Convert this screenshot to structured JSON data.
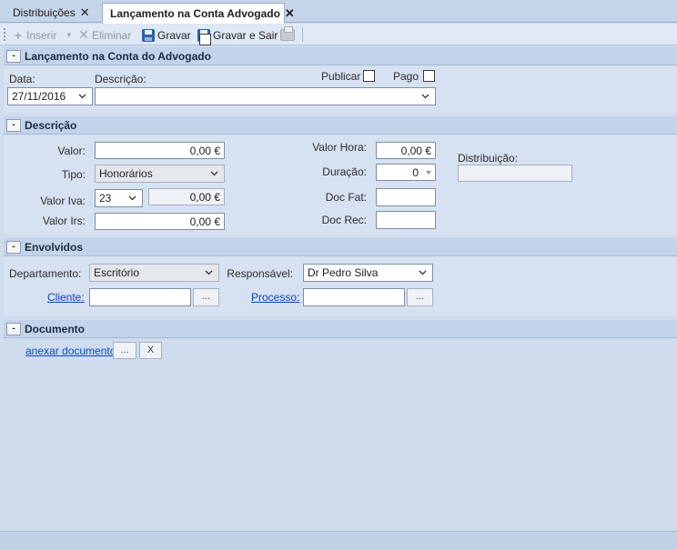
{
  "tabs": [
    {
      "label": "Distribuições",
      "active": false
    },
    {
      "label": "Lançamento na Conta Advogado",
      "active": true
    }
  ],
  "toolbar": {
    "insert_label": "Inserir",
    "delete_label": "Eliminar",
    "save_label": "Gravar",
    "save_exit_label": "Gravar e Sair"
  },
  "section_main": {
    "title": "Lançamento na Conta do Advogado",
    "date_label": "Data:",
    "date_value": "27/11/2016",
    "description_label": "Descrição:",
    "description_value": "",
    "publish_label": "Publicar",
    "paid_label": "Pago"
  },
  "section_description": {
    "title": "Descrição",
    "value_label": "Valor:",
    "value_value": "0,00 €",
    "type_label": "Tipo:",
    "type_value": "Honorários",
    "iva_label": "Valor Iva:",
    "iva_rate": "23",
    "iva_value": "0,00 €",
    "irs_label": "Valor Irs:",
    "irs_value": "0,00 €",
    "hour_value_label": "Valor Hora:",
    "hour_value_value": "0,00 €",
    "duration_label": "Duração:",
    "duration_value": "0",
    "doc_fat_label": "Doc Fat:",
    "doc_fat_value": "",
    "doc_rec_label": "Doc Rec:",
    "doc_rec_value": "",
    "distribution_label": "Distribuição:",
    "distribution_value": ""
  },
  "section_involved": {
    "title": "Envolvidos",
    "department_label": "Departamento:",
    "department_value": "Escritório",
    "responsible_label": "Responsável:",
    "responsible_value": "Dr Pedro Silva",
    "client_link": "Cliente:",
    "client_value": "",
    "process_link": "Processo:",
    "process_value": "",
    "browse_label": "...",
    "browse_label_2": "..."
  },
  "section_document": {
    "title": "Documento",
    "attach_link": "anexar documento",
    "browse_label": "...",
    "remove_label": "X"
  },
  "collapse_symbol": "-",
  "colors": {
    "background": "#cfdcee",
    "section_header": "#c3d3ea",
    "link": "#0a47c2",
    "save_icon": "#2d5fa8"
  }
}
